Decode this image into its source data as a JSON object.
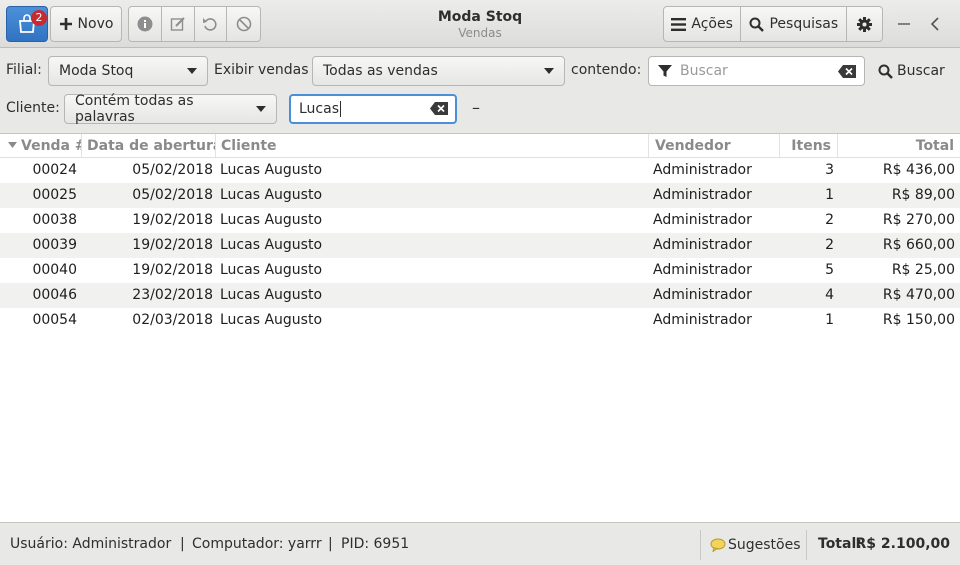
{
  "header": {
    "notification_count": "2",
    "new_label": "Novo",
    "title": "Moda Stoq",
    "subtitle": "Vendas",
    "actions_label": "Ações",
    "searches_label": "Pesquisas"
  },
  "filters": {
    "branch_label": "Filial:",
    "branch_value": "Moda Stoq",
    "show_sales_label": "Exibir vendas",
    "show_sales_value": "Todas as vendas",
    "containing_label": "contendo:",
    "search_placeholder": "Buscar",
    "search_button_label": "Buscar",
    "client_label": "Cliente:",
    "client_mode_value": "Contém todas as palavras",
    "client_value": "Lucas",
    "remove_symbol": "–"
  },
  "table": {
    "columns": [
      "Venda #",
      "Data de abertura",
      "Cliente",
      "Vendedor",
      "Itens",
      "Total"
    ],
    "rows": [
      [
        "00024",
        "05/02/2018",
        "Lucas Augusto",
        "Administrador",
        "3",
        "R$ 436,00"
      ],
      [
        "00025",
        "05/02/2018",
        "Lucas Augusto",
        "Administrador",
        "1",
        "R$ 89,00"
      ],
      [
        "00038",
        "19/02/2018",
        "Lucas Augusto",
        "Administrador",
        "2",
        "R$ 270,00"
      ],
      [
        "00039",
        "19/02/2018",
        "Lucas Augusto",
        "Administrador",
        "2",
        "R$ 660,00"
      ],
      [
        "00040",
        "19/02/2018",
        "Lucas Augusto",
        "Administrador",
        "5",
        "R$ 25,00"
      ],
      [
        "00046",
        "23/02/2018",
        "Lucas Augusto",
        "Administrador",
        "4",
        "R$ 470,00"
      ],
      [
        "00054",
        "02/03/2018",
        "Lucas Augusto",
        "Administrador",
        "1",
        "R$ 150,00"
      ]
    ]
  },
  "status": {
    "user": "Usuário: Administrador",
    "computer": "Computador: yarrr",
    "pid": "PID: 6951",
    "separator": "|",
    "suggestions_label": "Sugestões",
    "total_label": "Total:",
    "total_value": "R$ 2.100,00"
  },
  "colors": {
    "accent": "#3b7fcf",
    "badge": "#c62b32",
    "focus": "#4a90d9"
  }
}
